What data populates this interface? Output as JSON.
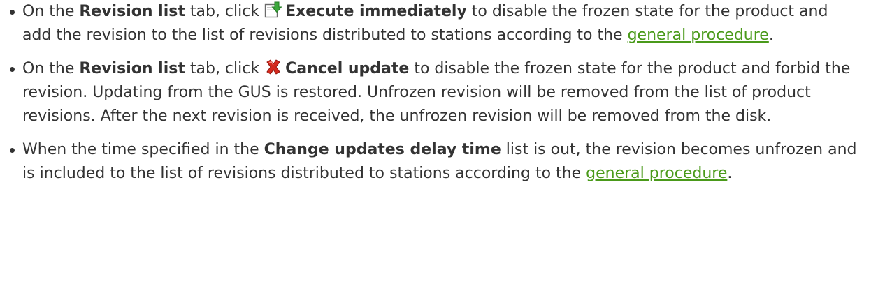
{
  "items": [
    {
      "t1": "On the ",
      "b1": "Revision list",
      "t2": " tab, click ",
      "icon": "execute-arrow-icon",
      "b2": "Execute immediately",
      "t3": " to disable the frozen state for the product and add the revision to the list of revisions distributed to stations according to the ",
      "link": "general procedure",
      "t4": "."
    },
    {
      "t1": "On the ",
      "b1": "Revision list",
      "t2": " tab, click ",
      "icon": "cancel-x-icon",
      "b2": "Cancel update",
      "t3": " to disable the frozen state for the product and forbid the revision. Updating from the GUS is restored. Unfrozen revision will be removed from the list of product revisions. After the next revision is received, the unfrozen revision will be removed from the disk."
    },
    {
      "t1": "When the time specified in the ",
      "b1": "Change updates delay time",
      "t2": " list is out, the revision becomes unfrozen and is included to the list of revisions distributed to stations according to the ",
      "link": "general procedure",
      "t3": "."
    }
  ],
  "colors": {
    "text": "#333333",
    "link": "#4a9a1a",
    "execute_icon_arrow": "#3ca83c",
    "cancel_icon": "#d42a1e"
  }
}
